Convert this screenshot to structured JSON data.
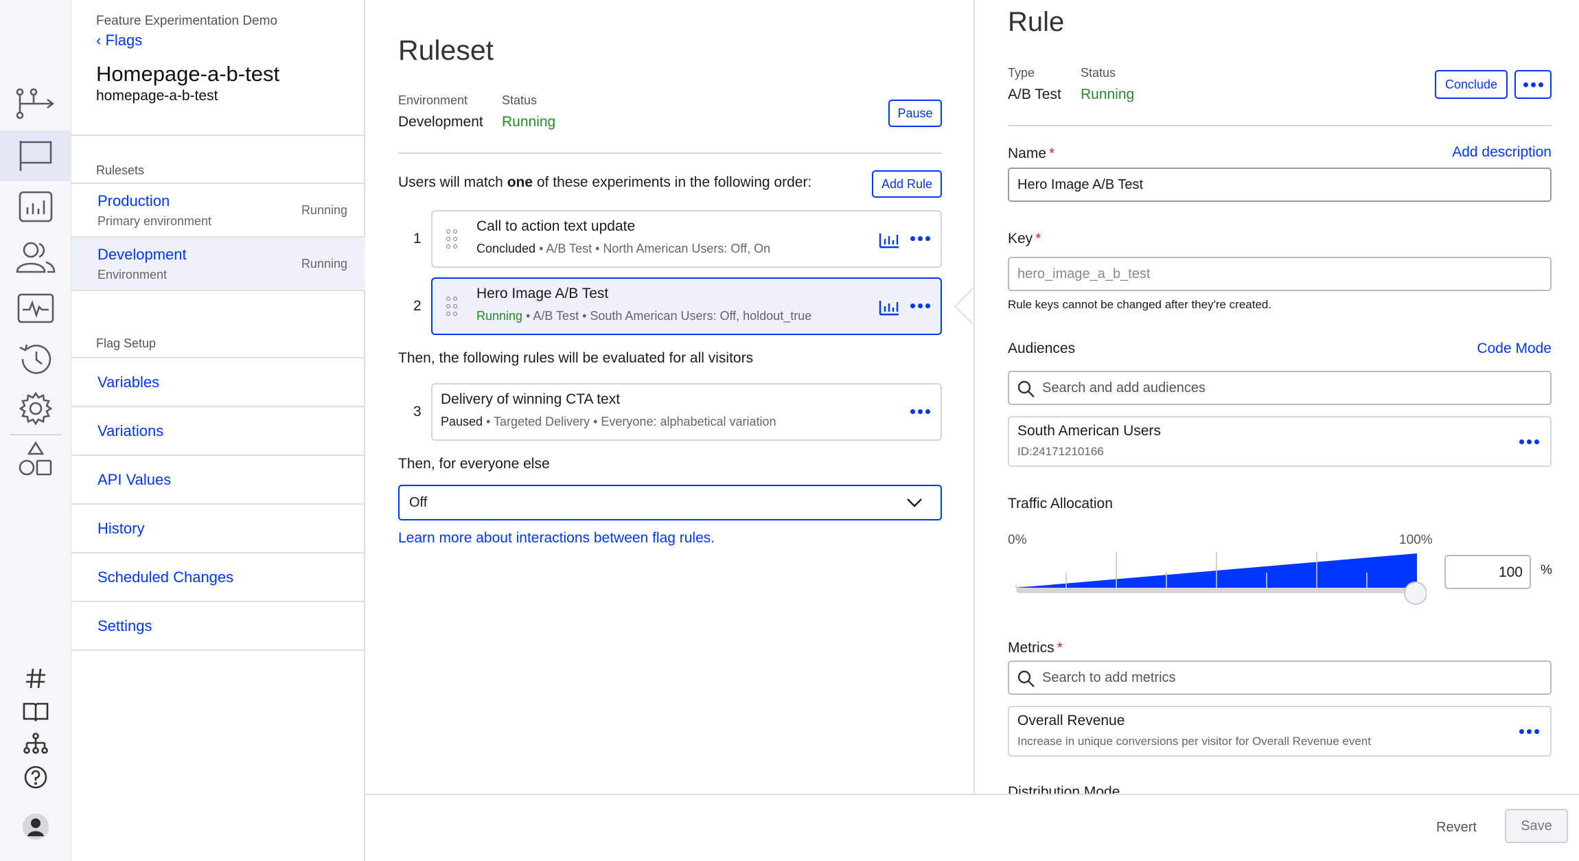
{
  "nav": {
    "project": "Feature Experimentation Demo",
    "back_label": "Flags",
    "flag_title": "Homepage-a-b-test",
    "flag_key": "homepage-a-b-test",
    "rulesets_heading": "Rulesets",
    "rulesets": [
      {
        "name": "Production",
        "sub": "Primary environment",
        "status": "Running"
      },
      {
        "name": "Development",
        "sub": "Environment",
        "status": "Running"
      }
    ],
    "setup_heading": "Flag Setup",
    "setup_items": [
      "Variables",
      "Variations",
      "API Values",
      "History",
      "Scheduled Changes",
      "Settings"
    ]
  },
  "ruleset": {
    "title": "Ruleset",
    "env_label": "Environment",
    "env_value": "Development",
    "status_label": "Status",
    "status_value": "Running",
    "pause_label": "Pause",
    "match_pre": "Users will match ",
    "match_bold": "one",
    "match_post": " of these experiments in the following order:",
    "add_rule_label": "Add Rule",
    "rules": [
      {
        "num": "1",
        "title": "Call to action text update",
        "status": "Concluded",
        "meta": " • A/B Test • North American Users: Off, On"
      },
      {
        "num": "2",
        "title": "Hero Image A/B Test",
        "status": "Running",
        "meta": " • A/B Test • South American Users: Off, holdout_true"
      },
      {
        "num": "3",
        "title": "Delivery of winning CTA text",
        "status": "Paused",
        "meta": " • Targeted Delivery • Everyone: alphabetical variation"
      }
    ],
    "then_all": "Then, the following rules will be evaluated for all visitors",
    "then_else": "Then, for everyone else",
    "fallback_value": "Off",
    "learn_more": "Learn more about interactions between flag rules."
  },
  "rule": {
    "title": "Rule",
    "type_label": "Type",
    "type_value": "A/B Test",
    "status_label": "Status",
    "status_value": "Running",
    "conclude_label": "Conclude",
    "name_label": "Name",
    "add_description": "Add description",
    "name_value": "Hero Image A/B Test",
    "key_label": "Key",
    "key_placeholder": "hero_image_a_b_test",
    "key_hint": "Rule keys cannot be changed after they're created.",
    "audiences_label": "Audiences",
    "code_mode": "Code Mode",
    "audience_search_placeholder": "Search and add audiences",
    "audience": {
      "name": "South American Users",
      "id": "ID:24171210166"
    },
    "traffic_label": "Traffic Allocation",
    "traffic_min": "0%",
    "traffic_max": "100%",
    "traffic_value": "100",
    "traffic_unit": "%",
    "traffic_fraction": 1.0,
    "metrics_label": "Metrics",
    "metrics_search_placeholder": "Search to add metrics",
    "metric": {
      "name": "Overall Revenue",
      "desc": "Increase in unique conversions per visitor for Overall Revenue event"
    },
    "distribution_mode_label": "Distribution Mode"
  },
  "footer": {
    "revert_label": "Revert",
    "save_label": "Save"
  },
  "colors": {
    "accent": "#0037ff",
    "running": "#268a26",
    "required": "#e0261a"
  }
}
